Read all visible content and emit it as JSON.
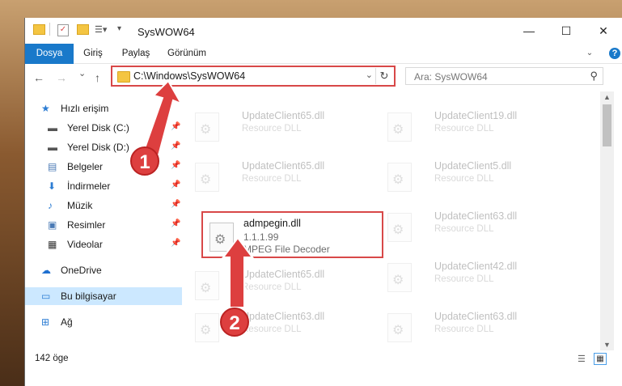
{
  "window": {
    "title": "SysWOW64",
    "minimize": "—",
    "maximize": "☐",
    "close": "✕"
  },
  "ribbon": {
    "tabs": [
      "Dosya",
      "Giriş",
      "Paylaş",
      "Görünüm"
    ],
    "help": "?"
  },
  "navbar": {
    "back": "←",
    "forward": "→",
    "recent": "⌄",
    "up": "↑",
    "address": "C:\\Windows\\SysWOW64",
    "address_dropdown": "⌄",
    "refresh": "↻",
    "search_placeholder": "Ara: SysWOW64",
    "search_icon": "⚲"
  },
  "sidebar": {
    "items": [
      {
        "label": "Hızlı erişim",
        "icon": "star-icon",
        "glyph": "★",
        "color": "#2b7cd3"
      },
      {
        "label": "Yerel Disk (C:)",
        "icon": "drive-icon",
        "glyph": "▬",
        "color": "#555555",
        "pin": "📌"
      },
      {
        "label": "Yerel Disk (D:)",
        "icon": "drive-icon",
        "glyph": "▬",
        "color": "#555555",
        "pin": "📌"
      },
      {
        "label": "Belgeler",
        "icon": "documents-icon",
        "glyph": "▤",
        "color": "#4a7ab5",
        "pin": "📌"
      },
      {
        "label": "İndirmeler",
        "icon": "downloads-icon",
        "glyph": "⬇",
        "color": "#2b7cd3",
        "pin": "📌"
      },
      {
        "label": "Müzik",
        "icon": "music-icon",
        "glyph": "♪",
        "color": "#2b7cd3",
        "pin": "📌"
      },
      {
        "label": "Resimler",
        "icon": "pictures-icon",
        "glyph": "▣",
        "color": "#4a7ab5",
        "pin": "📌"
      },
      {
        "label": "Videolar",
        "icon": "videos-icon",
        "glyph": "▦",
        "color": "#333333",
        "pin": "📌"
      },
      {
        "label": "OneDrive",
        "icon": "onedrive-icon",
        "glyph": "☁",
        "color": "#1e6fd0"
      },
      {
        "label": "Bu bilgisayar",
        "icon": "computer-icon",
        "glyph": "▭",
        "color": "#2b7cd3"
      },
      {
        "label": "Ağ",
        "icon": "network-icon",
        "glyph": "⊞",
        "color": "#2b7cd3"
      }
    ]
  },
  "files": {
    "left": [
      {
        "name": "UpdateClient65.dll",
        "desc": "Resource DLL"
      },
      {
        "name": "UpdateClient65.dll",
        "desc": "Resource DLL"
      },
      {
        "name": "admpegin.dll",
        "version": "1.1.1.99",
        "desc": "MPEG File Decoder",
        "highlighted": true
      },
      {
        "name": "UpdateClient65.dll",
        "desc": "Resource DLL"
      },
      {
        "name": "UpdateClient63.dll",
        "desc": "Resource DLL"
      }
    ],
    "right": [
      {
        "name": "UpdateClient19.dll",
        "desc": "Resource DLL"
      },
      {
        "name": "UpdateClient5.dll",
        "desc": "Resource DLL"
      },
      {
        "name": "UpdateClient63.dll",
        "desc": "Resource DLL"
      },
      {
        "name": "UpdateClient42.dll",
        "desc": "Resource DLL"
      },
      {
        "name": "UpdateClient63.dll",
        "desc": "Resource DLL"
      }
    ]
  },
  "status": {
    "count": "142 öge",
    "details_view": "☰",
    "icons_view": "▦"
  },
  "callouts": [
    "1",
    "2"
  ],
  "colors": {
    "accent": "#1979ca",
    "highlight": "#d84848",
    "selection": "#cce8ff"
  }
}
